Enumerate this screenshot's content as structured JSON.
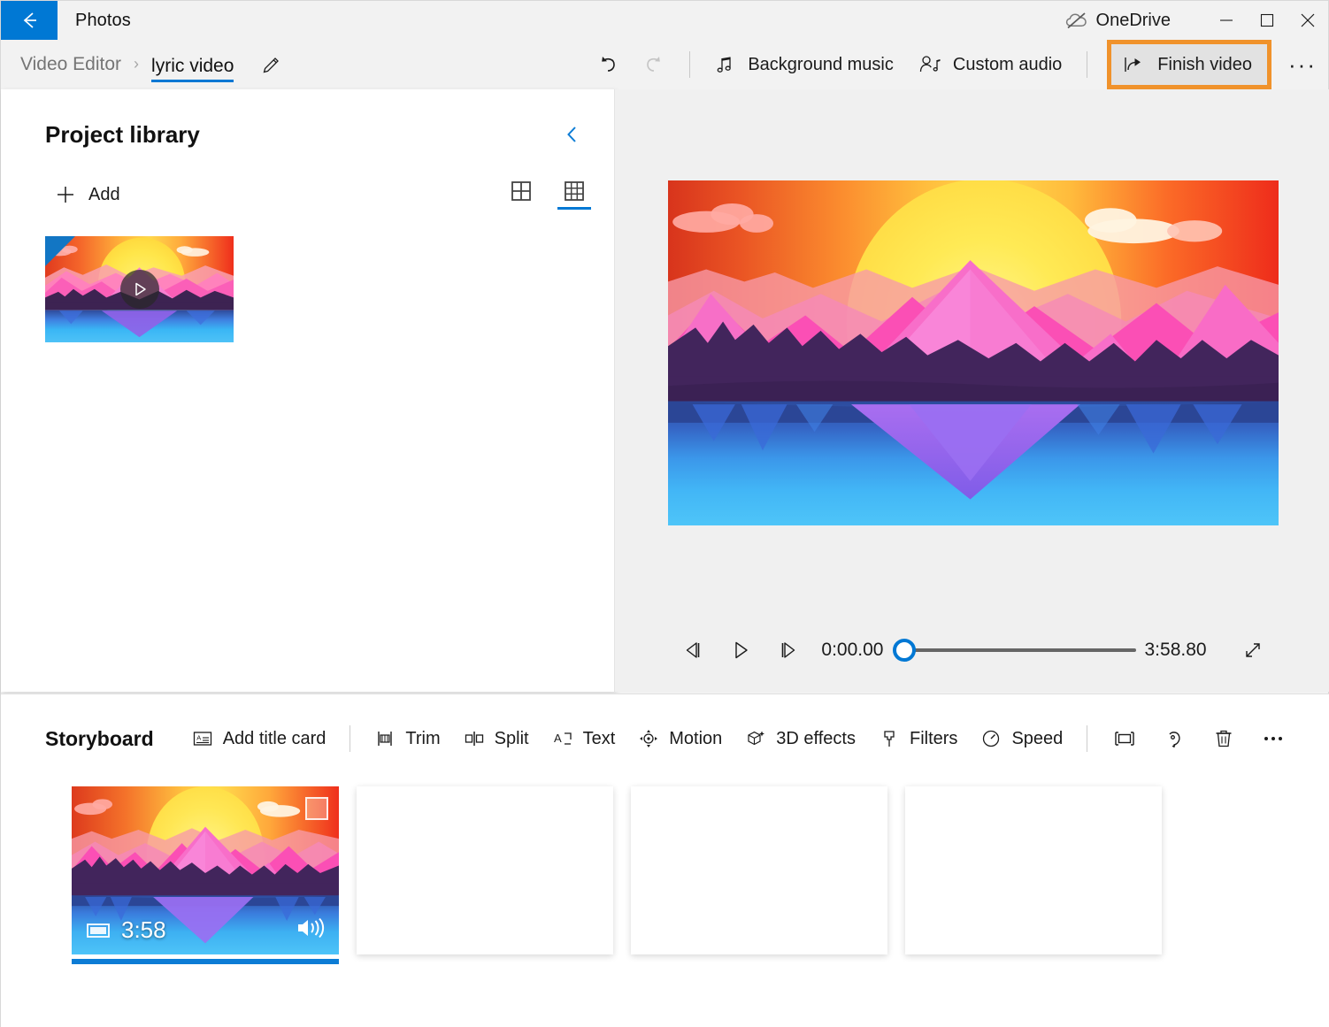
{
  "window": {
    "app_title": "Photos",
    "back_icon": "back-arrow-icon",
    "onedrive_label": "OneDrive",
    "onedrive_icon": "onedrive-cloud-offline-icon",
    "minimize_icon": "minimize-icon",
    "maximize_icon": "maximize-icon",
    "close_icon": "close-icon"
  },
  "commandbar": {
    "breadcrumb_parent": "Video Editor",
    "breadcrumb_separator": "›",
    "breadcrumb_current": "lyric video",
    "rename_icon": "pencil-edit-icon",
    "undo_icon": "undo-icon",
    "redo_icon": "redo-icon",
    "background_music_label": "Background music",
    "background_music_icon": "music-note-icon",
    "custom_audio_label": "Custom audio",
    "custom_audio_icon": "person-audio-icon",
    "finish_video_label": "Finish video",
    "finish_video_icon": "share-export-icon",
    "overflow_label": "···",
    "highlight_color": "#f0922b",
    "accent_color": "#0078d4"
  },
  "library": {
    "title": "Project library",
    "collapse_icon": "chevron-left-icon",
    "add_label": "Add",
    "add_icon": "plus-icon",
    "view_large_icon": "grid-large-icon",
    "view_small_icon": "grid-small-icon",
    "selected_view": "grid-small",
    "items": [
      {
        "name": "video-thumbnail",
        "play_icon": "play-icon",
        "selected": true
      }
    ]
  },
  "preview": {
    "prev_frame_icon": "previous-frame-icon",
    "play_icon": "play-icon",
    "next_frame_icon": "next-frame-icon",
    "current_time": "0:00.00",
    "total_time": "3:58.80",
    "progress_percent": 0,
    "expand_icon": "expand-fullscreen-icon"
  },
  "storyboard": {
    "title": "Storyboard",
    "add_title_card_label": "Add title card",
    "add_title_card_icon": "title-card-icon",
    "tools": [
      {
        "label": "Trim",
        "icon": "trim-icon"
      },
      {
        "label": "Split",
        "icon": "split-icon"
      },
      {
        "label": "Text",
        "icon": "text-icon"
      },
      {
        "label": "Motion",
        "icon": "motion-icon"
      },
      {
        "label": "3D effects",
        "icon": "3d-effects-icon"
      },
      {
        "label": "Filters",
        "icon": "filters-icon"
      },
      {
        "label": "Speed",
        "icon": "speed-icon"
      }
    ],
    "icon_tools": [
      {
        "name": "aspect-ratio-icon"
      },
      {
        "name": "rotate-icon"
      },
      {
        "name": "delete-icon"
      },
      {
        "name": "more-options-icon"
      }
    ],
    "clips": [
      {
        "duration": "3:58",
        "film_icon": "film-strip-icon",
        "volume_icon": "volume-icon",
        "selected": true
      }
    ],
    "empty_slot_count": 3
  }
}
